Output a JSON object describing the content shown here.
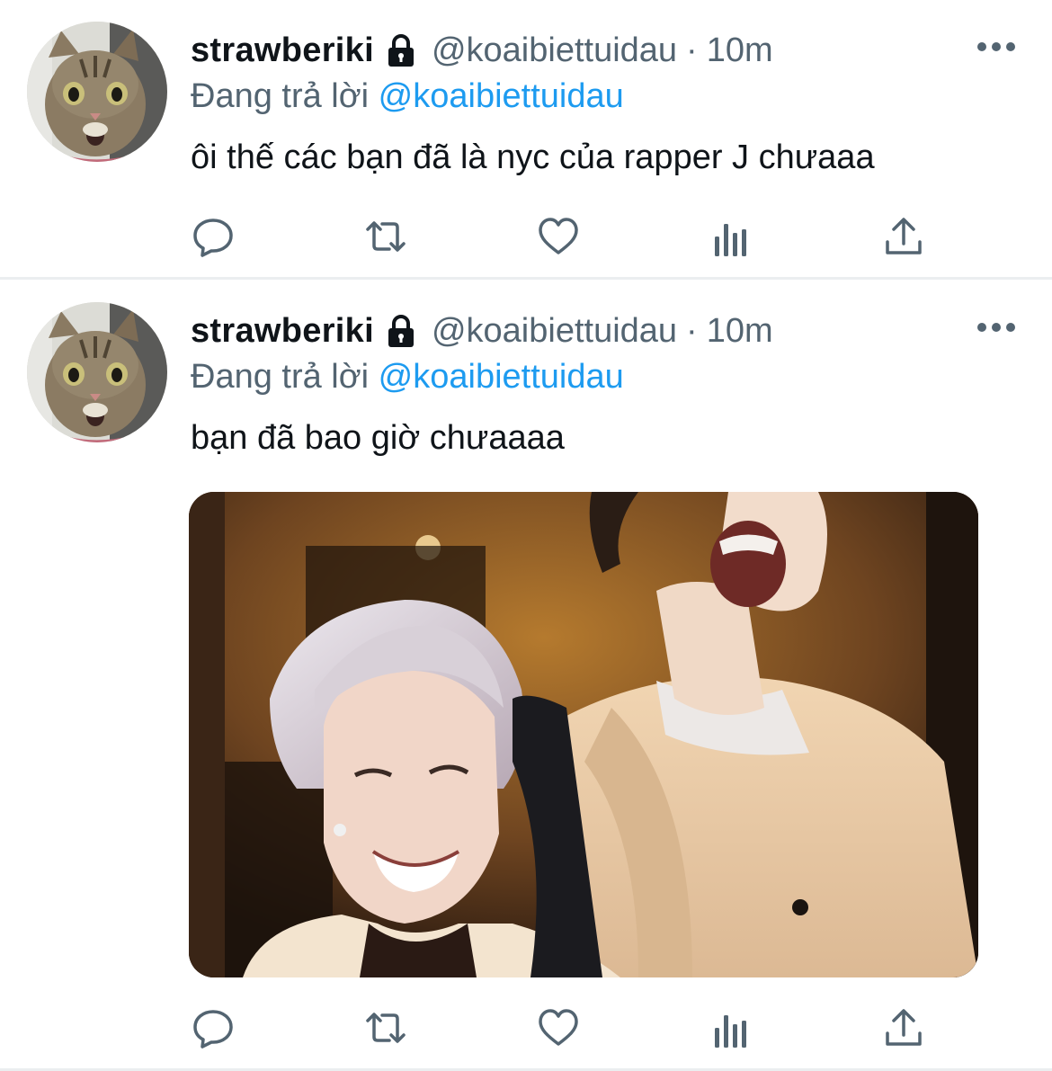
{
  "colors": {
    "text": "#0f1419",
    "secondary": "#536471",
    "link": "#1d9bf0",
    "divider": "#ebeef0"
  },
  "tweets": [
    {
      "display_name": "strawberiki",
      "handle": "@koaibiettuidau",
      "separator": "·",
      "time": "10m",
      "reply_prefix": "Đang trả lời",
      "reply_to": "@koaibiettuidau",
      "text": "ôi thế các bạn đã là nyc của rapper J chưaaa",
      "icons": {
        "avatar": "cat-avatar",
        "verified_lock": "lock-icon",
        "more": "more-icon",
        "actions": [
          "reply-icon",
          "retweet-icon",
          "like-icon",
          "analytics-icon",
          "share-icon"
        ]
      }
    },
    {
      "display_name": "strawberiki",
      "handle": "@koaibiettuidau",
      "separator": "·",
      "time": "10m",
      "reply_prefix": "Đang trả lời",
      "reply_to": "@koaibiettuidau",
      "text": "bạn đã bao giờ chưaaaa",
      "media": "photo-of-two-laughing-people",
      "icons": {
        "avatar": "cat-avatar",
        "verified_lock": "lock-icon",
        "more": "more-icon",
        "actions": [
          "reply-icon",
          "retweet-icon",
          "like-icon",
          "analytics-icon",
          "share-icon"
        ]
      }
    }
  ]
}
